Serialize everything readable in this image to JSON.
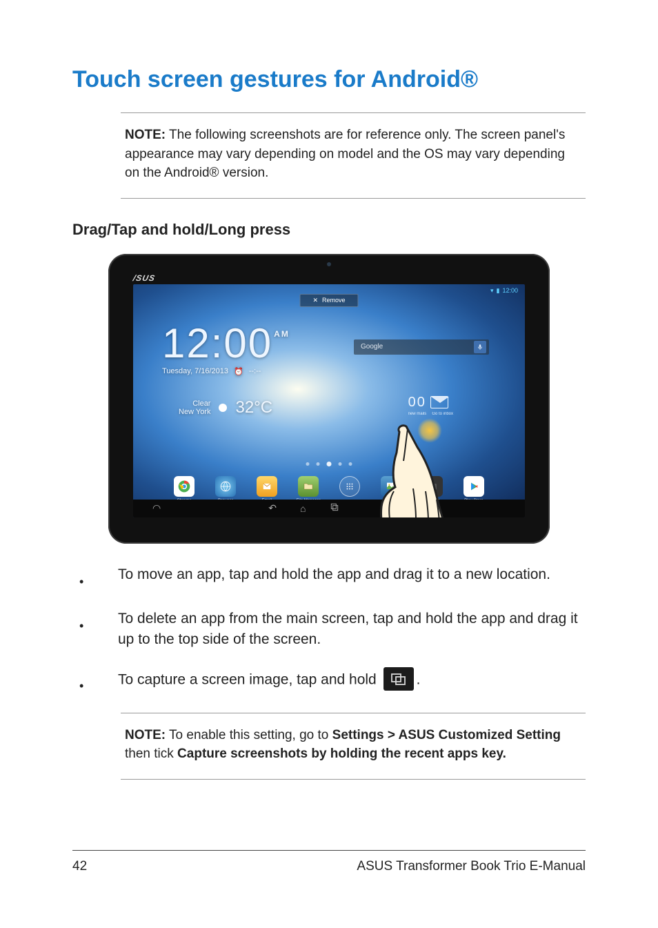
{
  "title": "Touch screen gestures for Android®",
  "note1": {
    "label": "NOTE:",
    "text": " The following screenshots are for reference only. The screen panel's appearance may vary depending on model and the OS may vary depending on the Android® version."
  },
  "subhead": "Drag/Tap and hold/Long press",
  "tablet": {
    "logo": "/SUS",
    "status_time": "12:00",
    "remove_label": "Remove",
    "clock_time": "12:00",
    "clock_ampm": "AM",
    "clock_date": "Tuesday, 7/16/2013",
    "alarm_placeholder": "--:--",
    "search_placeholder": "Google",
    "weather_condition": "Clear",
    "weather_city": "New York",
    "weather_temp": "32°C",
    "msg_count": "00",
    "msg_label_left": "new mails",
    "msg_label_right": "Go to inbox",
    "dock": {
      "chrome": "Chrome",
      "browser": "Browser",
      "email": "Email",
      "filemgr": "File Manager",
      "camera": "Camera",
      "playstore": "Play Store"
    }
  },
  "bullets": {
    "b1": "To move an app, tap and hold the app and drag it to a new location.",
    "b2": "To delete an app from the main screen, tap and hold the app and drag it up to the top side of the screen.",
    "b3_pre": "To capture a screen image, tap and hold ",
    "b3_post": "."
  },
  "note2": {
    "label": "NOTE:",
    "t1": "  To enable this setting, go to  ",
    "bold1": "Settings > ASUS Customized Setting",
    "t2": " then tick ",
    "bold2": "Capture screenshots by holding the recent apps key."
  },
  "footer": {
    "page": "42",
    "doc": "ASUS Transformer Book Trio E-Manual"
  }
}
